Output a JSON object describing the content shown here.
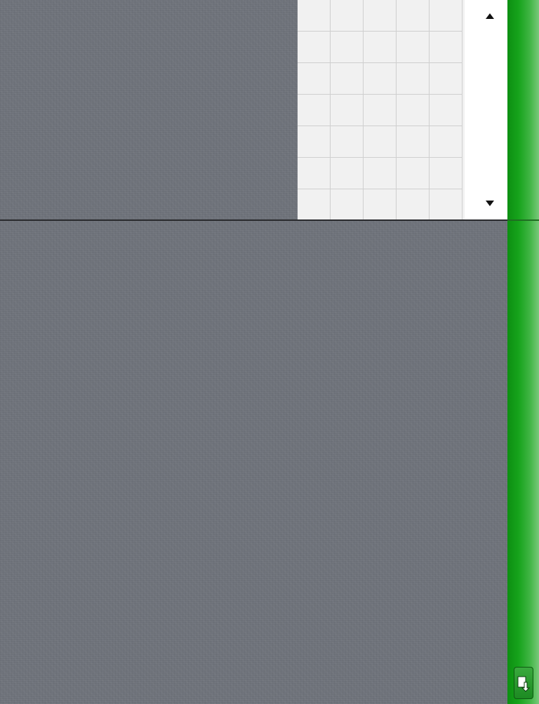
{
  "grid": {
    "columns": 5,
    "rows": 7
  },
  "scroll": {
    "up_icon": "triangle-up-icon",
    "down_icon": "triangle-down-icon"
  },
  "sidebar": {
    "export_icon": "document-export-icon"
  },
  "colors": {
    "background": "#6e727a",
    "sidebar_green": "#16a31b",
    "grid_bg": "#f1f1f1",
    "grid_line": "#cfcfcf",
    "scroll_bg": "#ffffff"
  }
}
